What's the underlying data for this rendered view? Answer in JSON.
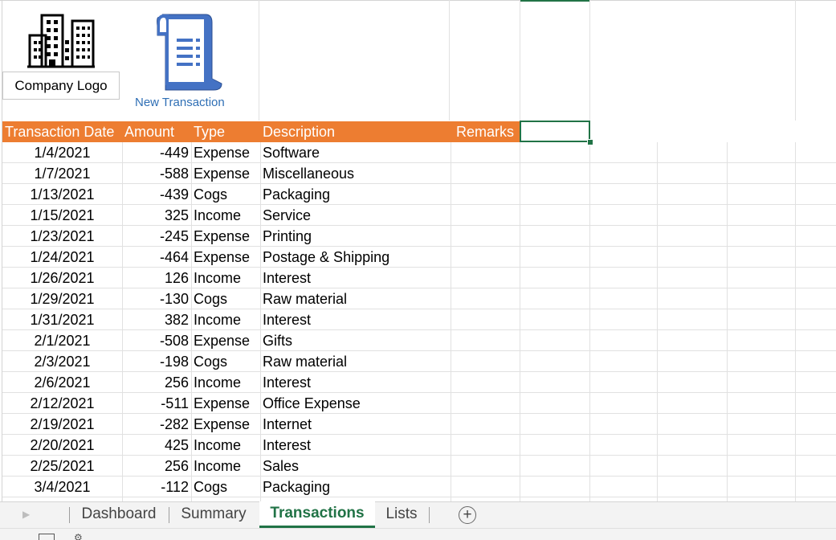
{
  "sheet": {
    "logo_label": "Company Logo",
    "new_transaction_label": "New Transaction",
    "icons": {
      "logo": "building-icon",
      "new_transaction": "receipt-icon"
    }
  },
  "table": {
    "headers": {
      "date": "Transaction Date",
      "amount": "Amount",
      "type": "Type",
      "description": "Description",
      "remarks": "Remarks"
    },
    "rows": [
      {
        "date": "1/4/2021",
        "amount": "-449",
        "type": "Expense",
        "description": "Software",
        "remarks": ""
      },
      {
        "date": "1/7/2021",
        "amount": "-588",
        "type": "Expense",
        "description": "Miscellaneous",
        "remarks": ""
      },
      {
        "date": "1/13/2021",
        "amount": "-439",
        "type": "Cogs",
        "description": "Packaging",
        "remarks": ""
      },
      {
        "date": "1/15/2021",
        "amount": "325",
        "type": "Income",
        "description": "Service",
        "remarks": ""
      },
      {
        "date": "1/23/2021",
        "amount": "-245",
        "type": "Expense",
        "description": "Printing",
        "remarks": ""
      },
      {
        "date": "1/24/2021",
        "amount": "-464",
        "type": "Expense",
        "description": "Postage & Shipping",
        "remarks": ""
      },
      {
        "date": "1/26/2021",
        "amount": "126",
        "type": "Income",
        "description": "Interest",
        "remarks": ""
      },
      {
        "date": "1/29/2021",
        "amount": "-130",
        "type": "Cogs",
        "description": "Raw material",
        "remarks": ""
      },
      {
        "date": "1/31/2021",
        "amount": "382",
        "type": "Income",
        "description": "Interest",
        "remarks": ""
      },
      {
        "date": "2/1/2021",
        "amount": "-508",
        "type": "Expense",
        "description": "Gifts",
        "remarks": ""
      },
      {
        "date": "2/3/2021",
        "amount": "-198",
        "type": "Cogs",
        "description": "Raw material",
        "remarks": ""
      },
      {
        "date": "2/6/2021",
        "amount": "256",
        "type": "Income",
        "description": "Interest",
        "remarks": ""
      },
      {
        "date": "2/12/2021",
        "amount": "-511",
        "type": "Expense",
        "description": "Office Expense",
        "remarks": ""
      },
      {
        "date": "2/19/2021",
        "amount": "-282",
        "type": "Expense",
        "description": "Internet",
        "remarks": ""
      },
      {
        "date": "2/20/2021",
        "amount": "425",
        "type": "Income",
        "description": "Interest",
        "remarks": ""
      },
      {
        "date": "2/25/2021",
        "amount": "256",
        "type": "Income",
        "description": "Sales",
        "remarks": ""
      },
      {
        "date": "3/4/2021",
        "amount": "-112",
        "type": "Cogs",
        "description": "Packaging",
        "remarks": ""
      }
    ]
  },
  "tabs": {
    "items": [
      "Dashboard",
      "Summary",
      "Transactions",
      "Lists"
    ],
    "active": "Transactions"
  },
  "colors": {
    "header_bg": "#ed7d31",
    "accent": "#217346",
    "link": "#2f6fb5",
    "icon_fill": "#4472c4"
  }
}
